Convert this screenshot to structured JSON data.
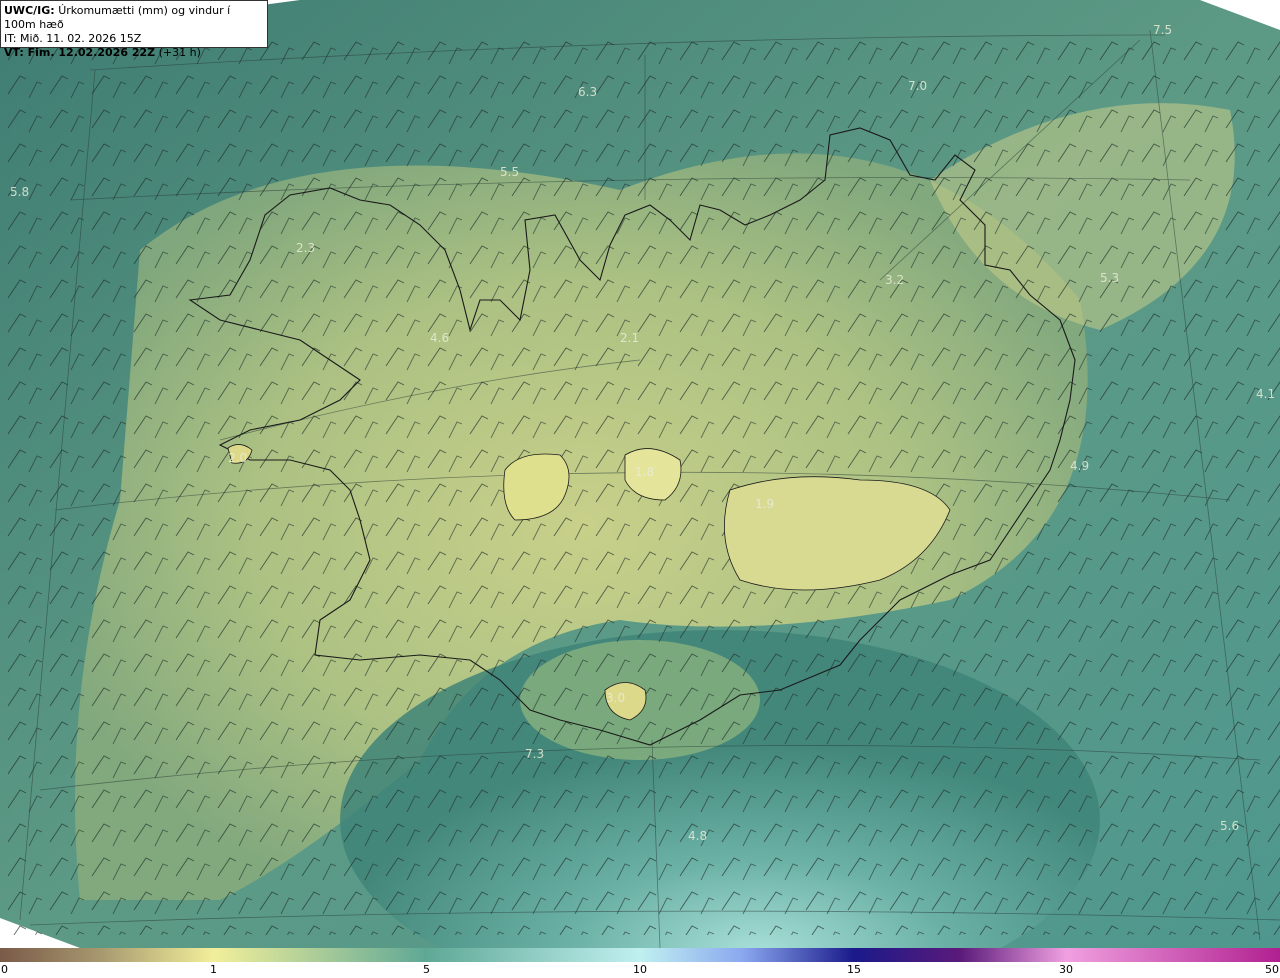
{
  "header": {
    "product": "UWC/IG:",
    "field": "Úrkomumætti (mm) og vindur í 100m hæð",
    "init_time": "IT: Mið. 11. 02. 2026 15Z",
    "valid_time": "VT: Fim. 12.02.2026 22Z",
    "lead": "(+31 h)"
  },
  "map_labels": [
    "6.3",
    "7.0",
    "7.5",
    "5.8",
    "5.5",
    "2.3",
    "3.2",
    "5.3",
    "4.6",
    "2.1",
    "4.1",
    "2.0",
    "1.8",
    "4.9",
    "1.9",
    "3.0",
    "7.3",
    "4.8",
    "5.6"
  ],
  "colorbar": {
    "ticks": [
      "0",
      "1",
      "5",
      "10",
      "15",
      "30",
      "50"
    ],
    "colors": [
      "#7a5a48",
      "#c9c08a",
      "#f2ef9a",
      "#5fa896",
      "#c0f0f0",
      "#a8c0ff",
      "#1a1a8a",
      "#3a0a6a",
      "#c070c0",
      "#f0a0e0",
      "#b02090"
    ]
  },
  "palette": {
    "ocean_dark": "#2f6b66",
    "ocean_mid": "#4f8f82",
    "land_low": "#a8bf80",
    "land_high": "#d8d88c",
    "ocean_light": "#9ad8d2"
  }
}
